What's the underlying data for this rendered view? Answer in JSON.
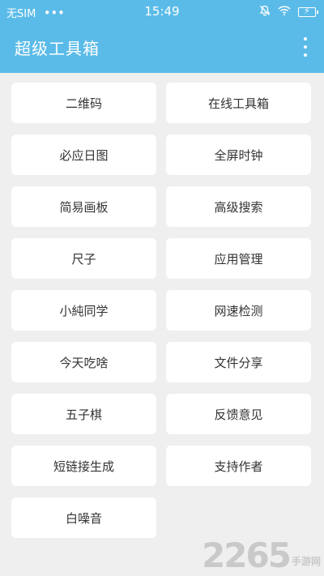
{
  "status_bar": {
    "carrier": "无SIM",
    "dots": "•••",
    "time": "15:49",
    "icons": [
      "mute-icon",
      "wifi-icon",
      "battery-charging-icon"
    ]
  },
  "app_bar": {
    "title": "超级工具箱",
    "menu_icon": "more-vert-icon"
  },
  "tools": [
    {
      "label": "二维码"
    },
    {
      "label": "在线工具箱"
    },
    {
      "label": "必应日图"
    },
    {
      "label": "全屏时钟"
    },
    {
      "label": "简易画板"
    },
    {
      "label": "高级搜索"
    },
    {
      "label": "尺子"
    },
    {
      "label": "应用管理"
    },
    {
      "label": "小純同学"
    },
    {
      "label": "网速检测"
    },
    {
      "label": "今天吃啥"
    },
    {
      "label": "文件分享"
    },
    {
      "label": "五子棋"
    },
    {
      "label": "反馈意见"
    },
    {
      "label": "短链接生成"
    },
    {
      "label": "支持作者"
    },
    {
      "label": "白噪音"
    }
  ],
  "watermark": {
    "number": "2265",
    "suffix": "手游网"
  },
  "colors": {
    "primary": "#5bbbe8",
    "background": "#efefef",
    "card": "#ffffff",
    "text": "#333333"
  }
}
